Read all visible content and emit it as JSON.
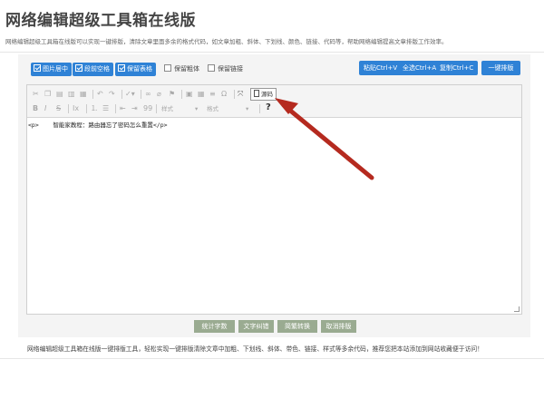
{
  "header": {
    "title": "网络编辑超级工具箱在线版",
    "description": "网络编辑超级工具箱在线版可以实现一键排版，清除文章里面多余的格式代码，如文章加粗、斜体、下划线、颜色、链接、代码等，帮助网络编辑提高文章排版工作效率。"
  },
  "options": {
    "buttons": [
      "图片居中",
      "段前空格",
      "保留表格"
    ],
    "checkboxes": [
      "保留粗体",
      "保留链接"
    ]
  },
  "actions": {
    "paste": "粘贴Ctrl+V",
    "select_all": "全选Ctrl+A",
    "copy": "复制Ctrl+C",
    "format": "一键排版"
  },
  "toolbar": {
    "style_dropdown": "样式",
    "format_dropdown": "格式",
    "source_label": "源码",
    "help_label": "?",
    "bold": "B",
    "italic": "I",
    "strike": "S",
    "quote": "99"
  },
  "editor": {
    "content": "<p>    智能家教程：路由器忘了密码怎么重置</p>"
  },
  "bottom_buttons": [
    "统计字数",
    "文字纠错",
    "简繁转换",
    "取消排版"
  ],
  "footer": {
    "text": "网络编辑超级工具箱在线版一键排版工具，轻松实现一键排版清除文章中加粗、下划线、斜体、带色、链接、样式等多余代码，推荐您把本站添加到网站收藏便于访问！"
  },
  "annotation": {
    "arrow_color": "#b52a1f"
  }
}
